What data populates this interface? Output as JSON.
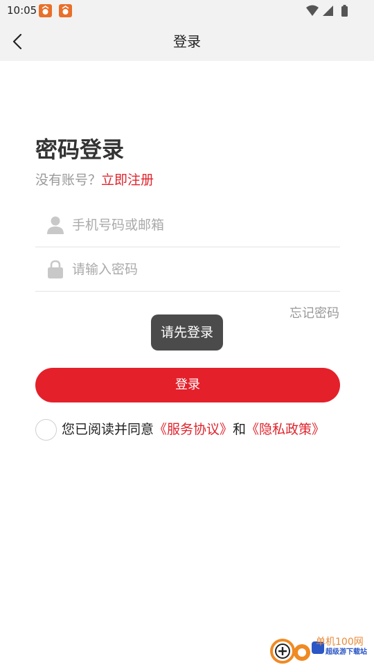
{
  "status_bar": {
    "time": "10:05",
    "notification_icons": [
      "app-notification-icon",
      "app-notification-icon"
    ],
    "system_icons": [
      "wifi-icon",
      "signal-icon",
      "battery-icon"
    ]
  },
  "title_bar": {
    "title": "登录",
    "back_icon": "chevron-left-icon"
  },
  "form": {
    "heading": "密码登录",
    "no_account_text": "没有账号？",
    "register_link": "立即注册",
    "account_placeholder": "手机号码或邮箱",
    "account_value": "",
    "password_placeholder": "请输入密码",
    "password_value": "",
    "forgot_password": "忘记密码",
    "login_button": "登录"
  },
  "toast": {
    "text": "请先登录"
  },
  "agreement": {
    "checked": false,
    "prefix": "您已阅读并同意",
    "service_link": "《服务协议》",
    "conjunction": "和",
    "privacy_link": "《隐私政策》"
  },
  "watermark": {
    "line1": "单机100网",
    "line2": "超级游下载站"
  },
  "colors": {
    "accent": "#e4202b",
    "link": "#e0232c",
    "toast_bg": "#4b4b4b",
    "bar_bg": "#f2f2f2"
  }
}
